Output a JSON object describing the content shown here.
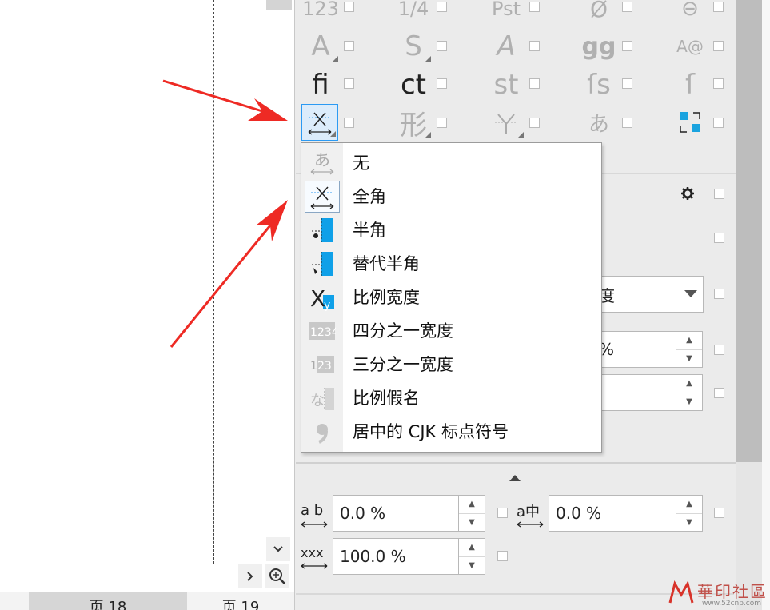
{
  "document": {
    "page_tabs": [
      "页 18",
      "页 19"
    ],
    "active_tab": 0
  },
  "glyph_rows": [
    [
      "123",
      "1/4",
      "Pst",
      "Ø",
      "⊖"
    ],
    [
      "A",
      "S",
      "A",
      "gg",
      "A@"
    ],
    [
      "ﬁ",
      "ct",
      "st",
      "ſs",
      "ſ"
    ],
    [
      "",
      "形",
      "",
      "あ",
      ""
    ]
  ],
  "dropdown": {
    "items": [
      {
        "label": "无",
        "icon": "hiragana-a-spacing-icon"
      },
      {
        "label": "全角",
        "icon": "full-width-icon"
      },
      {
        "label": "半角",
        "icon": "half-width-icon"
      },
      {
        "label": "替代半角",
        "icon": "alternate-half-width-icon"
      },
      {
        "label": "比例宽度",
        "icon": "proportional-width-icon"
      },
      {
        "label": "四分之一宽度",
        "icon": "quarter-width-icon"
      },
      {
        "label": "三分之一宽度",
        "icon": "third-width-icon"
      },
      {
        "label": "比例假名",
        "icon": "proportional-kana-icon"
      },
      {
        "label": "居中的 CJK 标点符号",
        "icon": "centered-cjk-punctuation-icon"
      }
    ],
    "selected_index": 1
  },
  "panel": {
    "combo_value": "度",
    "percent_field_suffix": "%",
    "spacing_ab_label": "a b",
    "spacing_ab_value": "0.0 %",
    "spacing_azh_label": "a中",
    "spacing_azh_value": "0.0 %",
    "scale_label": "xxx",
    "scale_value": "100.0 %"
  },
  "watermark": {
    "text": "華印社區",
    "url_text": "www.52cnp.com"
  },
  "colors": {
    "accent": "#2b9af3",
    "arrow": "#ee2a24",
    "panel_bg": "#ebebeb"
  }
}
